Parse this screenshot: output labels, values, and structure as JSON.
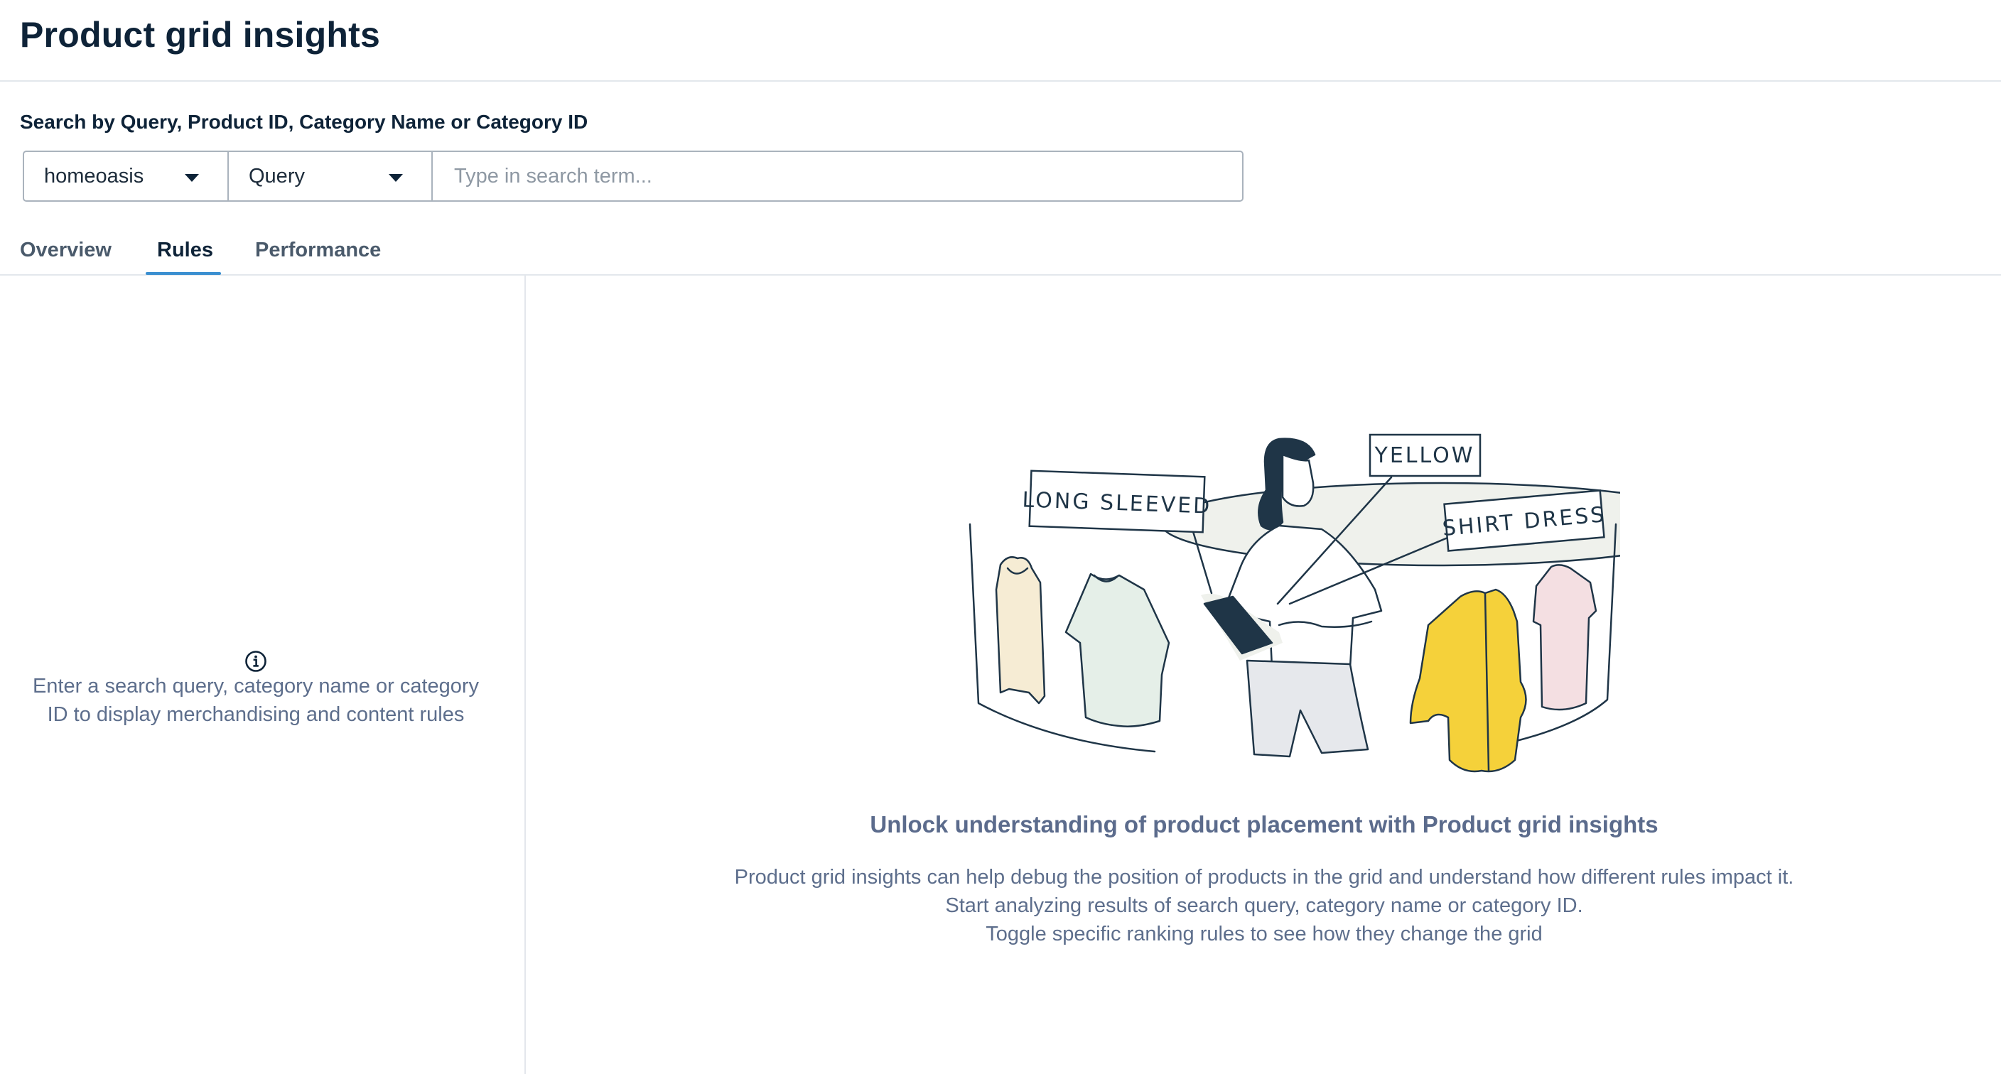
{
  "page": {
    "title": "Product grid insights"
  },
  "search": {
    "label": "Search by Query, Product ID, Category Name or Category ID",
    "site_select": "homeoasis",
    "type_select": "Query",
    "placeholder": "Type in search term...",
    "value": ""
  },
  "tabs": [
    {
      "label": "Overview",
      "active": false
    },
    {
      "label": "Rules",
      "active": true
    },
    {
      "label": "Performance",
      "active": false
    }
  ],
  "left_panel": {
    "icon": "info-icon",
    "message_line1": "Enter a search query, category name or category",
    "message_line2": "ID to display merchandising and content rules"
  },
  "illustration": {
    "tag_left": "LONG SLEEVED",
    "tag_top": "YELLOW",
    "tag_right": "SHIRT DRESS"
  },
  "main": {
    "heading": "Unlock understanding of product placement with Product grid insights",
    "lines": [
      "Product grid insights can help debug the position of products in the grid and understand how different rules impact it.",
      "Start analyzing results of search query, category name or category ID.",
      "Toggle specific ranking rules to see how they change the grid"
    ]
  },
  "colors": {
    "accent": "#3a8fd0",
    "title": "#0e2338",
    "muted_text": "#5d6e8c",
    "border": "#e3e7ec",
    "yellow": "#f5d13a"
  }
}
